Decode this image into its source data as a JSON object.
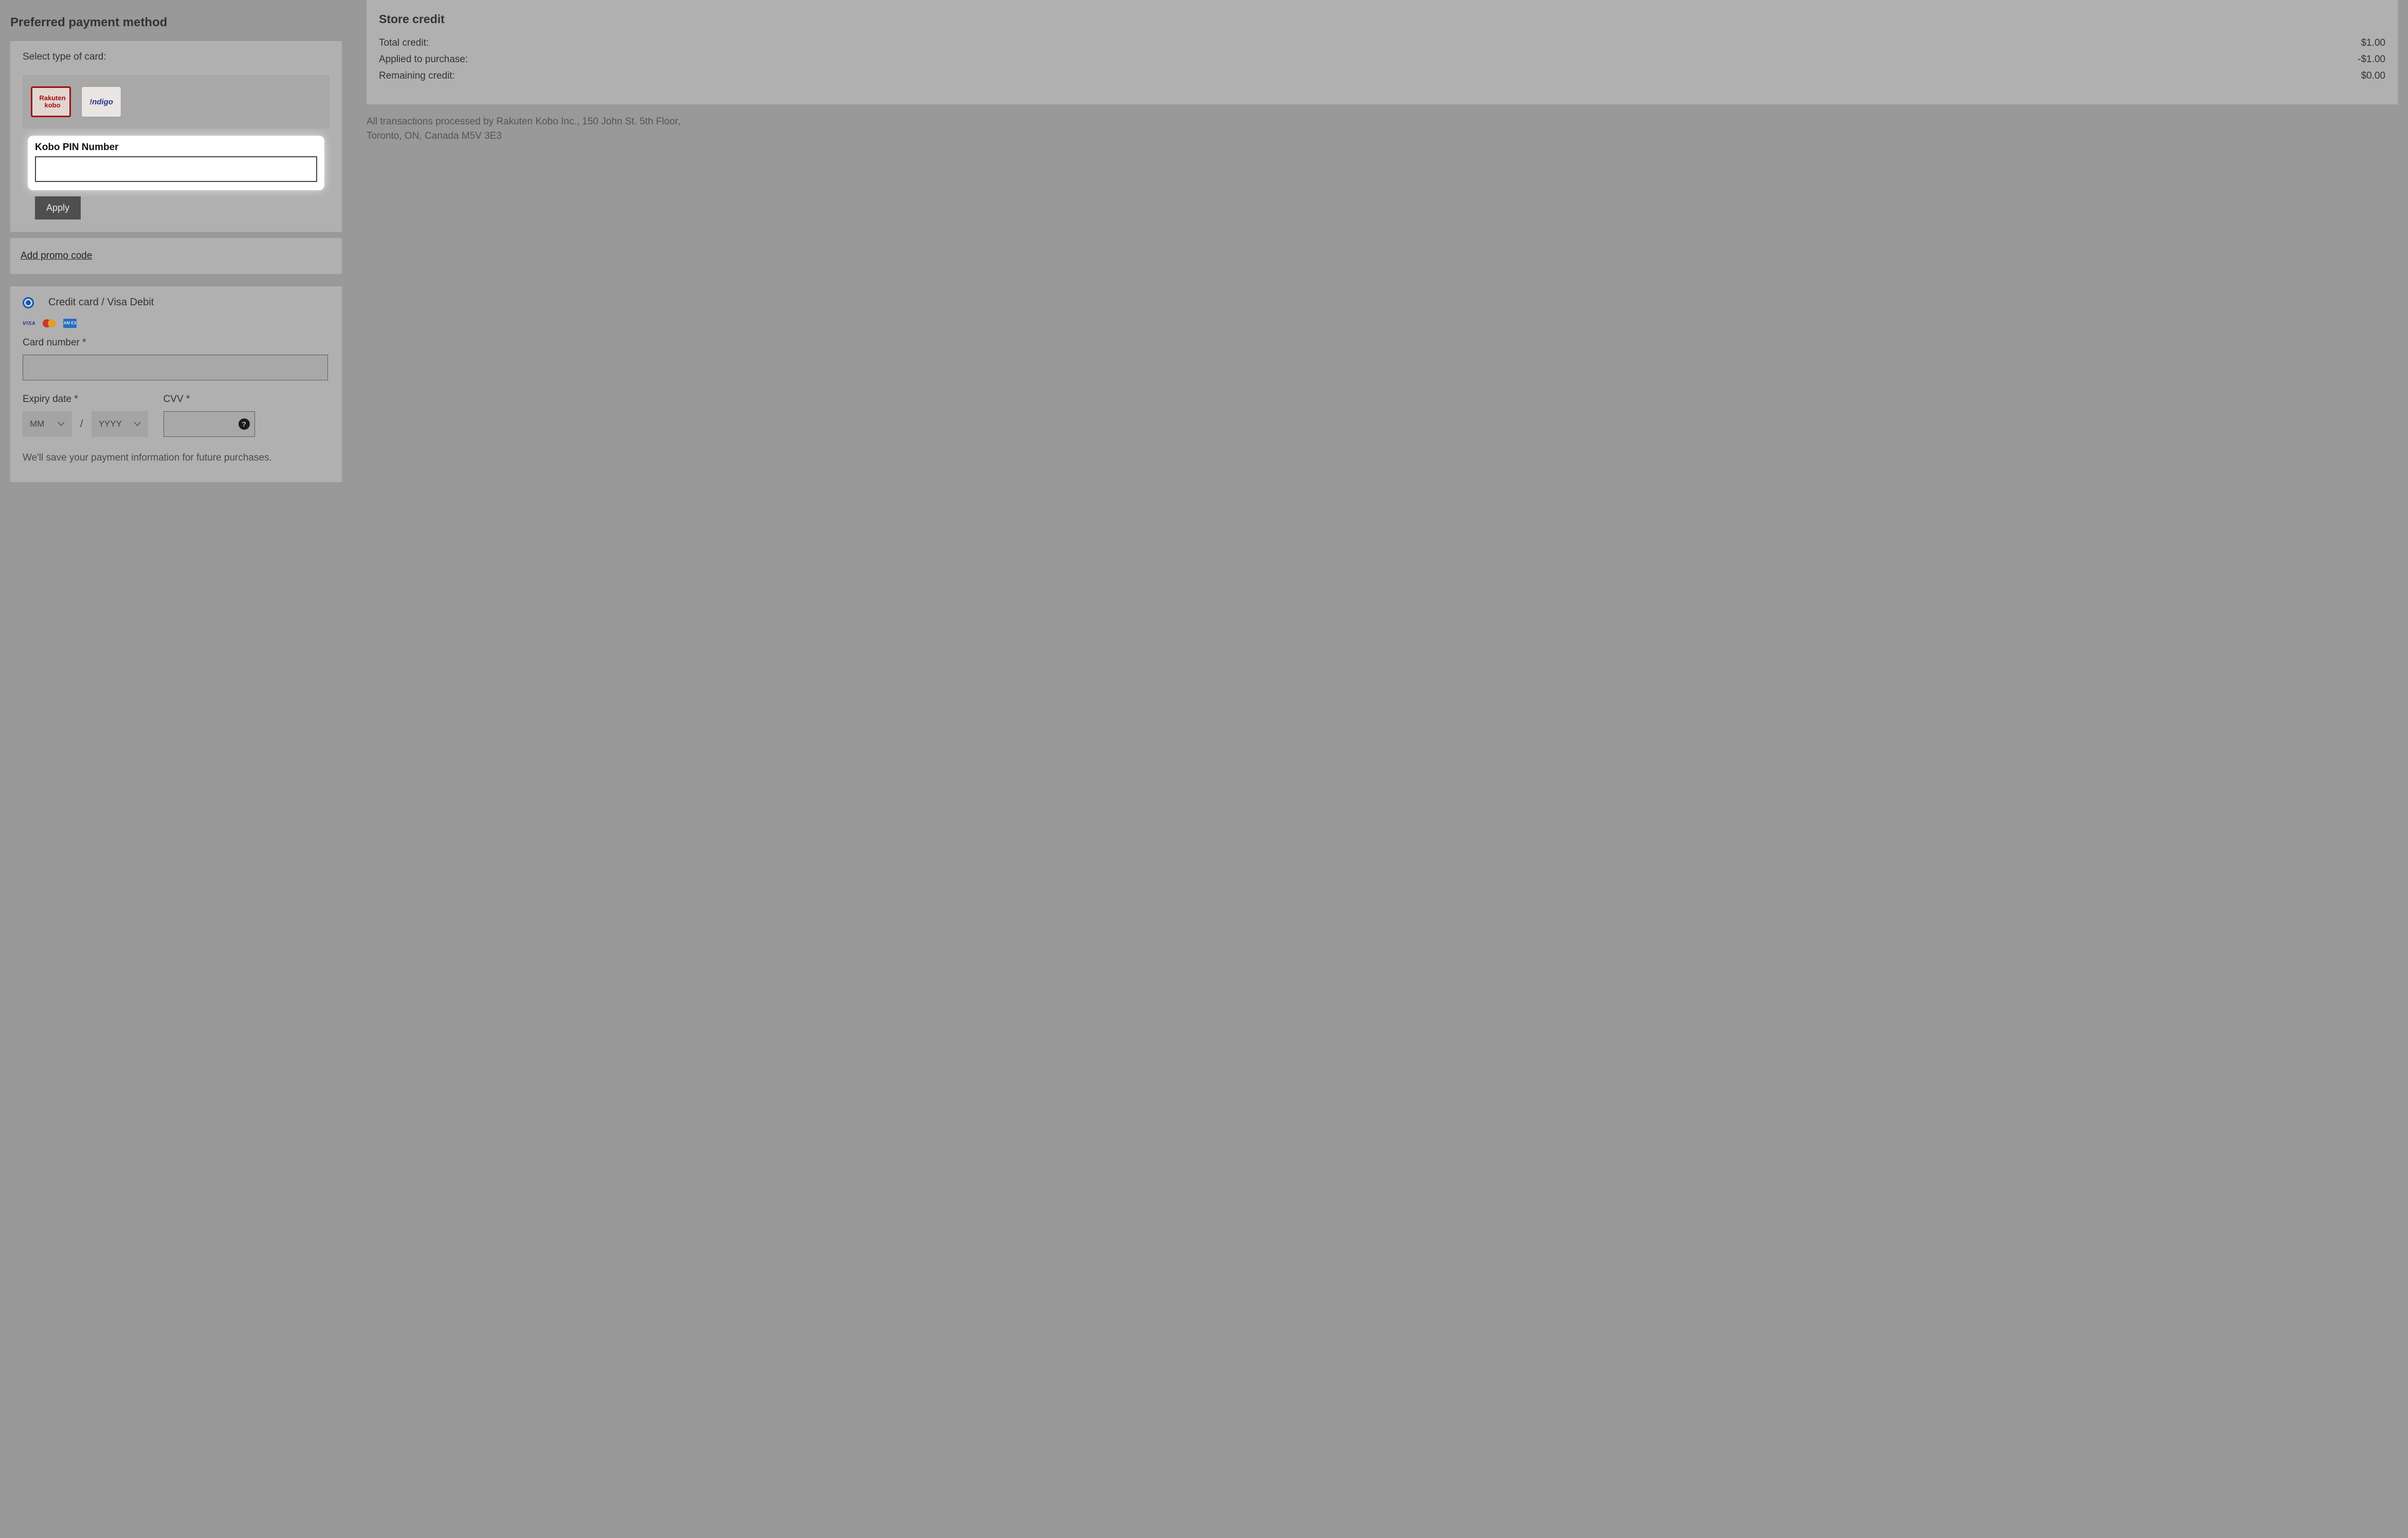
{
  "left": {
    "title": "Preferred payment method",
    "card_select_label": "Select type of card:",
    "cards": {
      "kobo_line1": "Rakuten",
      "kobo_line2": "kobo",
      "indigo": "!ndigo"
    },
    "pin_label": "Kobo PIN Number",
    "pin_value": "",
    "apply_label": "Apply",
    "promo_link": "Add promo code",
    "cc": {
      "radio_label": "Credit card / Visa Debit",
      "visa": "VISA",
      "amex": "AM\nEX",
      "card_number_label": "Card number *",
      "card_number_value": "",
      "expiry_label": "Expiry date *",
      "mm_placeholder": "MM",
      "yyyy_placeholder": "YYYY",
      "slash": "/",
      "cvv_label": "CVV *",
      "cvv_value": "",
      "help_char": "?",
      "save_note": "We'll save your payment information for future purchases."
    }
  },
  "right": {
    "title": "Store credit",
    "rows": [
      {
        "label": "Total credit:",
        "value": "$1.00"
      },
      {
        "label": "Applied to purchase:",
        "value": "-$1.00"
      },
      {
        "label": "Remaining credit:",
        "value": "$0.00"
      }
    ],
    "disclaimer": "All transactions processed by Rakuten Kobo Inc., 150 John St. 5th Floor, Toronto, ON, Canada M5V 3E3"
  }
}
